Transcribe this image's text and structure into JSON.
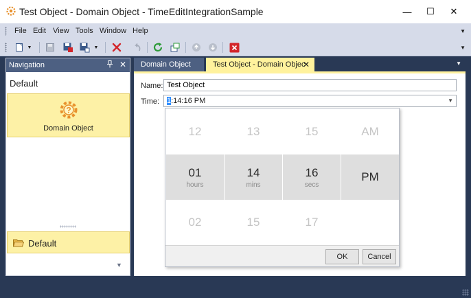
{
  "window": {
    "title": "Test Object - Domain Object - TimeEditIntegrationSample",
    "minimize_glyph": "—",
    "maximize_glyph": "☐",
    "close_glyph": "✕"
  },
  "menu": {
    "items": [
      "File",
      "Edit",
      "View",
      "Tools",
      "Window",
      "Help"
    ],
    "overflow_glyph": "▼"
  },
  "toolbar": {
    "icons": [
      "new-icon",
      "new-dropdown-icon",
      "save-icon",
      "save-and-close-icon",
      "save-and-new-icon",
      "save-dropdown-icon",
      "delete-icon",
      "undo-icon",
      "refresh-icon",
      "new-window-icon",
      "previous-icon",
      "next-icon",
      "close-icon"
    ],
    "dropdown_glyph": "▼",
    "overflow_glyph": "▼"
  },
  "navigation": {
    "header": "Navigation",
    "pin_glyph": "📌",
    "close_glyph": "✕",
    "group_title": "Default",
    "item_label": "Domain Object",
    "bar_item_label": "Default",
    "expand_glyph": "▼"
  },
  "tabs": [
    {
      "label": "Domain Object",
      "active": false
    },
    {
      "label": "Test Object - Domain Objec",
      "active": true
    }
  ],
  "tab_close_glyph": "✕",
  "tab_menu_glyph": "▼",
  "form": {
    "name_label": "Name:",
    "name_value": "Test Object",
    "time_label": "Time:",
    "time_selected_char": "1",
    "time_rest": ":14:16 PM",
    "dropdown_glyph": "▼"
  },
  "time_picker": {
    "above": [
      "12",
      "13",
      "15",
      "AM"
    ],
    "selected": [
      {
        "value": "01",
        "unit": "hours"
      },
      {
        "value": "14",
        "unit": "mins"
      },
      {
        "value": "16",
        "unit": "secs"
      },
      {
        "value": "PM",
        "unit": ""
      }
    ],
    "below": [
      "02",
      "15",
      "17"
    ],
    "ok_label": "OK",
    "cancel_label": "Cancel"
  },
  "colors": {
    "workspace": "#293955",
    "chrome": "#d6dbe9",
    "accent_yellow": "#fff29d",
    "header_blue": "#4d6082"
  }
}
